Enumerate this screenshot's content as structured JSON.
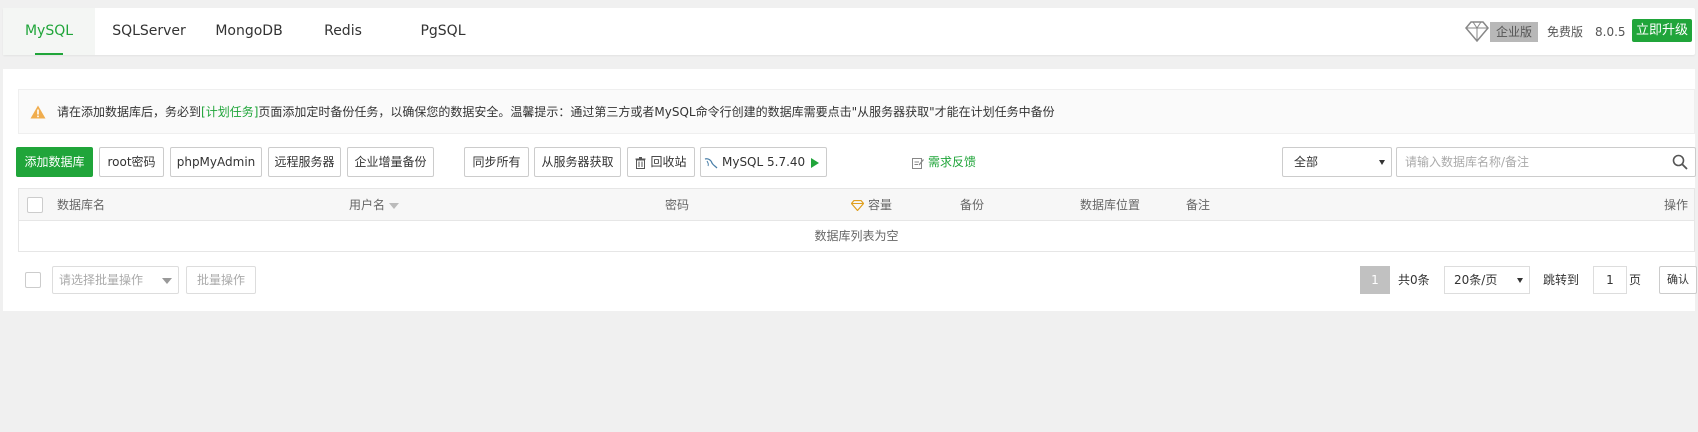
{
  "tabs": [
    {
      "label": "MySQL",
      "active": true
    },
    {
      "label": "SQLServer",
      "active": false
    },
    {
      "label": "MongoDB",
      "active": false
    },
    {
      "label": "Redis",
      "active": false
    },
    {
      "label": "PgSQL",
      "active": false
    }
  ],
  "version_info": {
    "enterprise_label": "企业版",
    "free_label": "免费版",
    "version": "8.0.5",
    "upgrade_label": "立即升级"
  },
  "notice": {
    "text_before": "请在添加数据库后，务必到",
    "link_text": "[计划任务]",
    "text_after": "页面添加定时备份任务，以确保您的数据安全。温馨提示：通过第三方或者MySQL命令行创建的数据库需要点击\"从服务器获取\"才能在计划任务中备份"
  },
  "toolbar": {
    "add_database": "添加数据库",
    "root_password": "root密码",
    "phpmyadmin": "phpMyAdmin",
    "remote_server": "远程服务器",
    "enterprise_backup": "企业增量备份",
    "sync_all": "同步所有",
    "fetch_from_server": "从服务器获取",
    "recycle_bin": "回收站",
    "mysql_version": "MySQL 5.7.40",
    "feedback": "需求反馈"
  },
  "filter": {
    "selected": "全部",
    "search_placeholder": "请输入数据库名称/备注"
  },
  "table": {
    "columns": {
      "name": "数据库名",
      "username": "用户名",
      "password": "密码",
      "capacity": "容量",
      "backup": "备份",
      "location": "数据库位置",
      "remark": "备注",
      "actions": "操作"
    },
    "empty_text": "数据库列表为空"
  },
  "footer": {
    "batch_placeholder": "请选择批量操作",
    "batch_button": "批量操作",
    "current_page": "1",
    "total": "共0条",
    "page_size": "20条/页",
    "jump_label": "跳转到",
    "jump_value": "1",
    "page_unit": "页",
    "confirm": "确认"
  },
  "colors": {
    "accent": "#20a53a",
    "warning": "#f0ad4e"
  }
}
